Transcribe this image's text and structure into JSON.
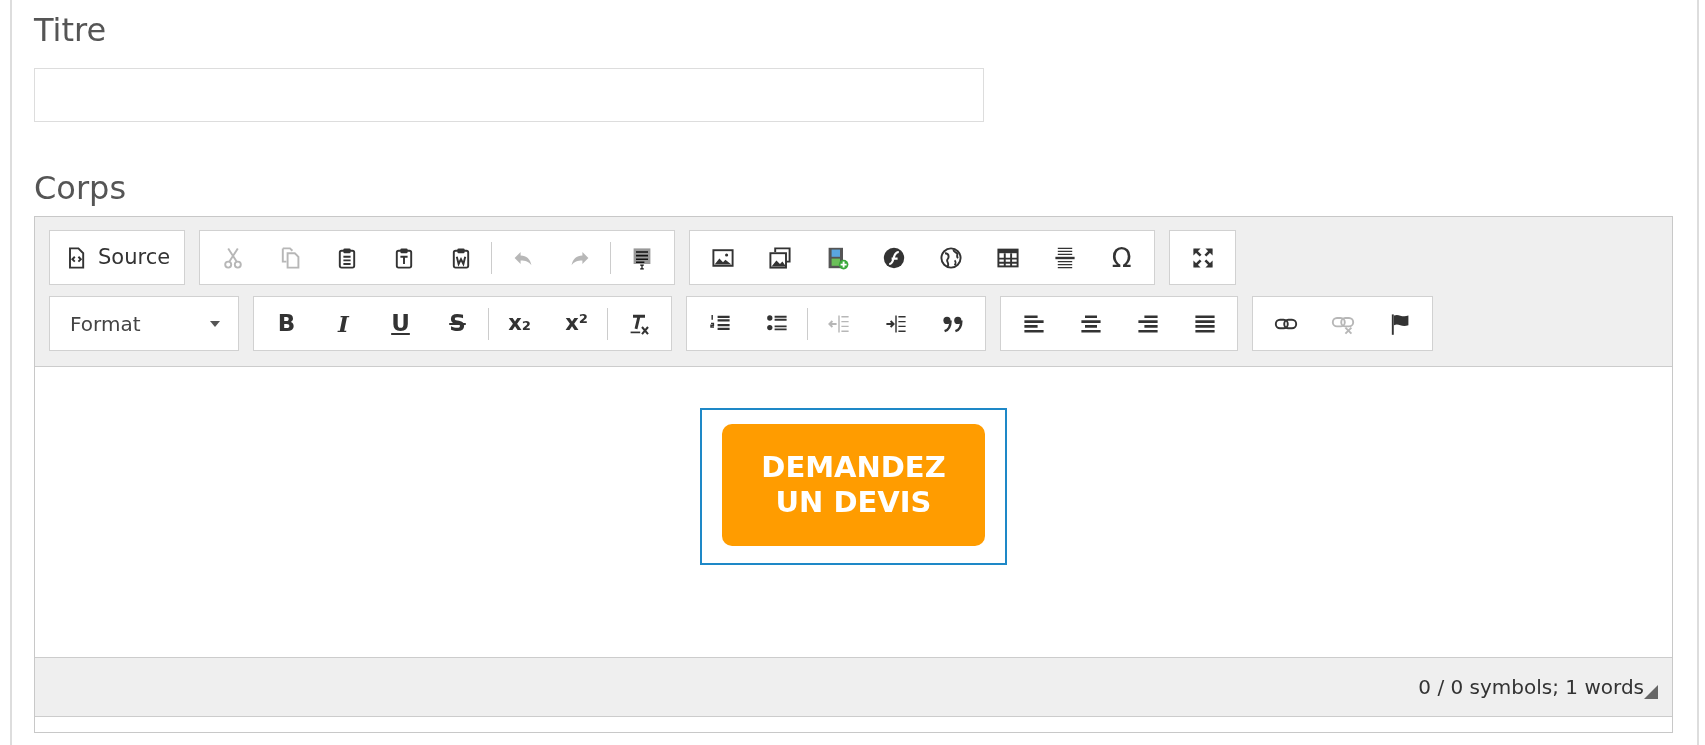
{
  "title_field": {
    "label": "Titre"
  },
  "body_field": {
    "label": "Corps"
  },
  "editor": {
    "toolbar_rows": [
      [
        {
          "items": [
            {
              "kind": "button",
              "label": "Source",
              "disabled": false
            }
          ]
        },
        {
          "items": [
            {
              "kind": "button",
              "disabled": true
            },
            {
              "kind": "button",
              "disabled": true
            },
            {
              "kind": "button",
              "disabled": false
            },
            {
              "kind": "button",
              "disabled": false
            },
            {
              "kind": "button",
              "disabled": false
            },
            {
              "kind": "separator"
            },
            {
              "kind": "button",
              "disabled": true
            },
            {
              "kind": "button",
              "disabled": true
            },
            {
              "kind": "separator"
            },
            {
              "kind": "button",
              "disabled": false
            }
          ]
        },
        {
          "items": [
            {
              "kind": "button",
              "disabled": false
            },
            {
              "kind": "button",
              "disabled": false
            },
            {
              "kind": "button",
              "disabled": false
            },
            {
              "kind": "button",
              "disabled": false
            },
            {
              "kind": "button",
              "disabled": false
            },
            {
              "kind": "button",
              "disabled": false
            },
            {
              "kind": "button",
              "disabled": false
            },
            {
              "kind": "button",
              "glyph": "Ω",
              "disabled": false
            }
          ]
        },
        {
          "items": [
            {
              "kind": "button",
              "disabled": false
            }
          ]
        }
      ],
      [
        {
          "items": [
            {
              "kind": "combo",
              "label": "Format"
            }
          ]
        },
        {
          "items": [
            {
              "kind": "button",
              "glyph": "B",
              "disabled": false
            },
            {
              "kind": "button",
              "glyph": "I",
              "disabled": false
            },
            {
              "kind": "button",
              "glyph": "U",
              "disabled": false
            },
            {
              "kind": "button",
              "glyph": "S",
              "disabled": false
            },
            {
              "kind": "separator"
            },
            {
              "kind": "button",
              "glyph": "x₂",
              "disabled": false
            },
            {
              "kind": "button",
              "glyph": "x²",
              "disabled": false
            },
            {
              "kind": "separator"
            },
            {
              "kind": "button",
              "disabled": false
            }
          ]
        },
        {
          "items": [
            {
              "kind": "button",
              "disabled": false
            },
            {
              "kind": "button",
              "disabled": false
            },
            {
              "kind": "separator"
            },
            {
              "kind": "button",
              "disabled": true
            },
            {
              "kind": "button",
              "disabled": false
            },
            {
              "kind": "button",
              "disabled": false
            }
          ]
        },
        {
          "items": [
            {
              "kind": "button",
              "disabled": false
            },
            {
              "kind": "button",
              "disabled": false
            },
            {
              "kind": "button",
              "disabled": false
            },
            {
              "kind": "button",
              "disabled": false
            }
          ]
        },
        {
          "items": [
            {
              "kind": "button",
              "disabled": false
            },
            {
              "kind": "button",
              "disabled": true
            },
            {
              "kind": "button",
              "disabled": false
            }
          ]
        }
      ]
    ],
    "content_image": {
      "lines": [
        "DEMANDEZ",
        "UN DEVIS"
      ],
      "selected": true
    },
    "status_text": "0 / 0 symbols; 1 words"
  }
}
